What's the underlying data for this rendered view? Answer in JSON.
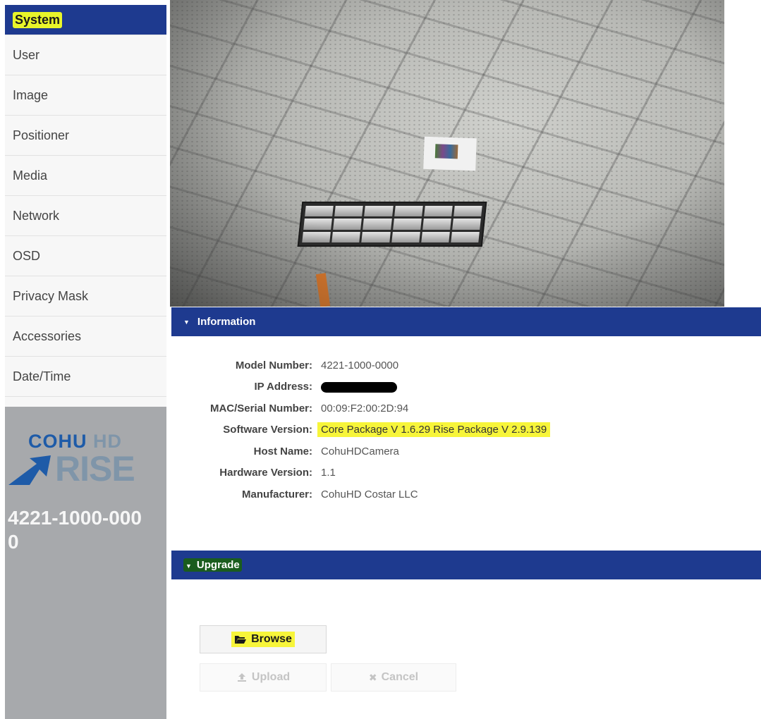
{
  "sidebar": {
    "items": [
      {
        "label": "System"
      },
      {
        "label": "User"
      },
      {
        "label": "Image"
      },
      {
        "label": "Positioner"
      },
      {
        "label": "Media"
      },
      {
        "label": "Network"
      },
      {
        "label": "OSD"
      },
      {
        "label": "Privacy Mask"
      },
      {
        "label": "Accessories"
      },
      {
        "label": "Date/Time"
      }
    ],
    "logo": {
      "line1_a": "COHU",
      "line1_b": "HD",
      "line2": "RISE"
    },
    "model": "4221-1000-0000"
  },
  "information": {
    "title": "Information",
    "rows": [
      {
        "label": "Model Number:",
        "value": "4221-1000-0000"
      },
      {
        "label": "IP Address:",
        "value": ""
      },
      {
        "label": "MAC/Serial Number:",
        "value": "00:09:F2:00:2D:94"
      },
      {
        "label": "Software Version:",
        "value": "Core Package V 1.6.29 Rise Package V 2.9.139"
      },
      {
        "label": "Host Name:",
        "value": "CohuHDCamera"
      },
      {
        "label": "Hardware Version:",
        "value": "1.1"
      },
      {
        "label": "Manufacturer:",
        "value": "CohuHD Costar LLC"
      }
    ]
  },
  "upgrade": {
    "title": "Upgrade",
    "browse_label": "Browse",
    "upload_label": "Upload",
    "cancel_label": "Cancel"
  },
  "colors": {
    "header_blue": "#1e3a8f",
    "sidebar_gray": "#a7a9ac",
    "highlight_yellow": "#f7f53a"
  }
}
